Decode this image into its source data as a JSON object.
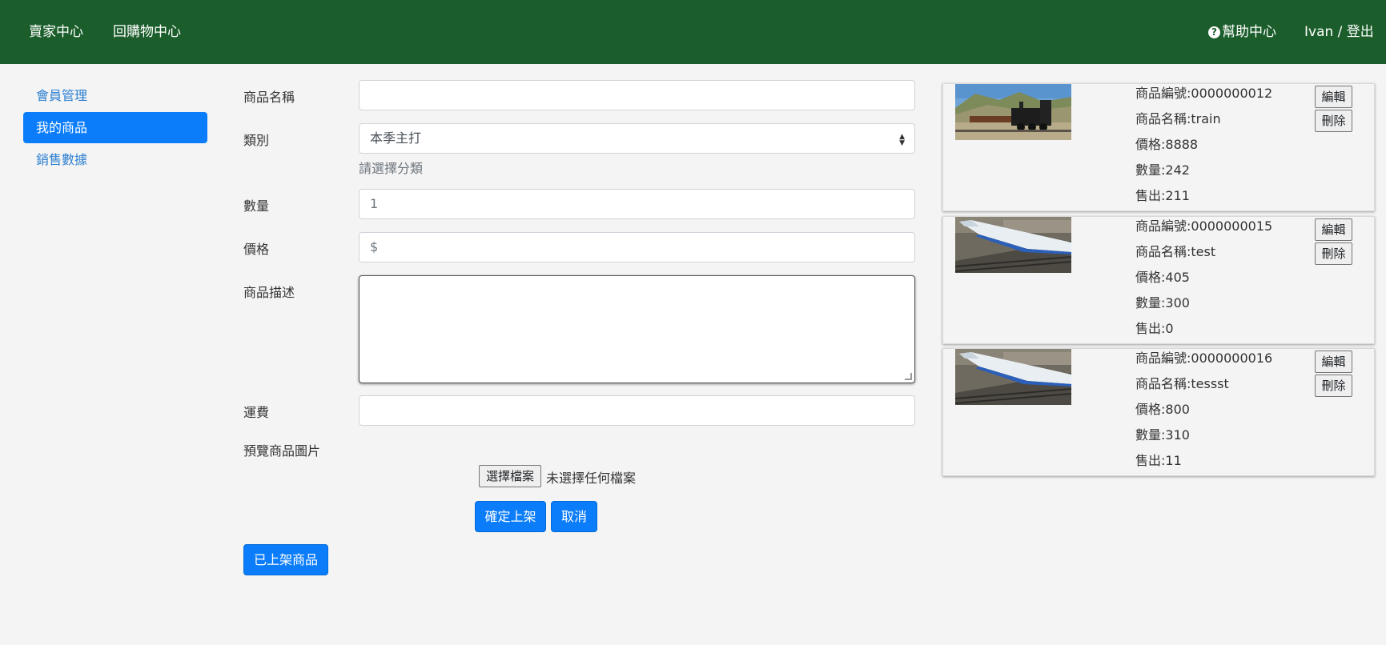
{
  "header": {
    "seller_center": "賣家中心",
    "back_to_shop": "回購物中心",
    "help_center": "幫助中心",
    "user_logout": "Ivan / 登出"
  },
  "sidebar": {
    "items": [
      {
        "label": "會員管理",
        "active": false
      },
      {
        "label": "我的商品",
        "active": true
      },
      {
        "label": "銷售數據",
        "active": false
      }
    ]
  },
  "form": {
    "name_label": "商品名稱",
    "name_value": "",
    "category_label": "類別",
    "category_value": "本季主打",
    "category_hint": "請選擇分類",
    "quantity_label": "數量",
    "quantity_placeholder": "1",
    "price_label": "價格",
    "price_placeholder": "$",
    "description_label": "商品描述",
    "description_value": "",
    "shipping_label": "運費",
    "shipping_value": "",
    "preview_label": "預覽商品圖片",
    "file_button": "選擇檔案",
    "file_status": "未選擇任何檔案",
    "submit_label": "確定上架",
    "cancel_label": "取消",
    "listed_label": "已上架商品"
  },
  "products": [
    {
      "id_line": "商品編號:0000000012",
      "name_line": "商品名稱:train",
      "price_line": "價格:8888",
      "qty_line": "數量:242",
      "sold_line": "售出:211",
      "image": "steam-train-photo",
      "edit_label": "編輯",
      "delete_label": "刪除"
    },
    {
      "id_line": "商品編號:0000000015",
      "name_line": "商品名稱:test",
      "price_line": "價格:405",
      "qty_line": "數量:300",
      "sold_line": "售出:0",
      "image": "bullet-train-photo",
      "edit_label": "編輯",
      "delete_label": "刪除"
    },
    {
      "id_line": "商品編號:0000000016",
      "name_line": "商品名稱:tessst",
      "price_line": "價格:800",
      "qty_line": "數量:310",
      "sold_line": "售出:11",
      "image": "bullet-train-photo",
      "edit_label": "編輯",
      "delete_label": "刪除"
    }
  ],
  "colors": {
    "header_bg": "#1b5e2b",
    "primary": "#0b7dfa",
    "link": "#2b7fd1"
  }
}
